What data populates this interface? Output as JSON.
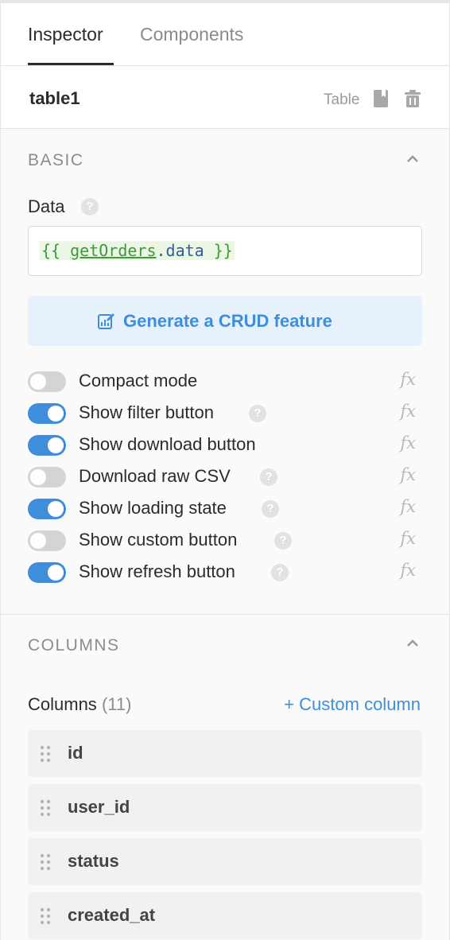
{
  "tabs": [
    {
      "label": "Inspector",
      "active": true
    },
    {
      "label": "Components",
      "active": false
    }
  ],
  "component": {
    "name": "table1",
    "type": "Table"
  },
  "basic": {
    "title": "BASIC",
    "data_label": "Data",
    "data_value": {
      "open": "{{ ",
      "ident": "getOrders",
      "rest": ".data",
      "close": " }}"
    },
    "crud_button": "Generate a CRUD feature",
    "toggles": [
      {
        "label": "Compact mode",
        "on": false,
        "help": false
      },
      {
        "label": "Show filter button",
        "on": true,
        "help": true
      },
      {
        "label": "Show download button",
        "on": true,
        "help": false
      },
      {
        "label": "Download raw CSV",
        "on": false,
        "help": true
      },
      {
        "label": "Show loading state",
        "on": true,
        "help": true
      },
      {
        "label": "Show custom button",
        "on": false,
        "help": true
      },
      {
        "label": "Show refresh button",
        "on": true,
        "help": true
      }
    ],
    "fx_label": "fx",
    "help_glyph": "?"
  },
  "columns_section": {
    "title": "COLUMNS",
    "label": "Columns",
    "count": "(11)",
    "add_custom": "+ Custom column",
    "items": [
      "id",
      "user_id",
      "status",
      "created_at"
    ]
  },
  "colors": {
    "accent": "#3f8edb",
    "toggle_off": "#d4d4d4",
    "code_green": "#3e9a3a"
  }
}
